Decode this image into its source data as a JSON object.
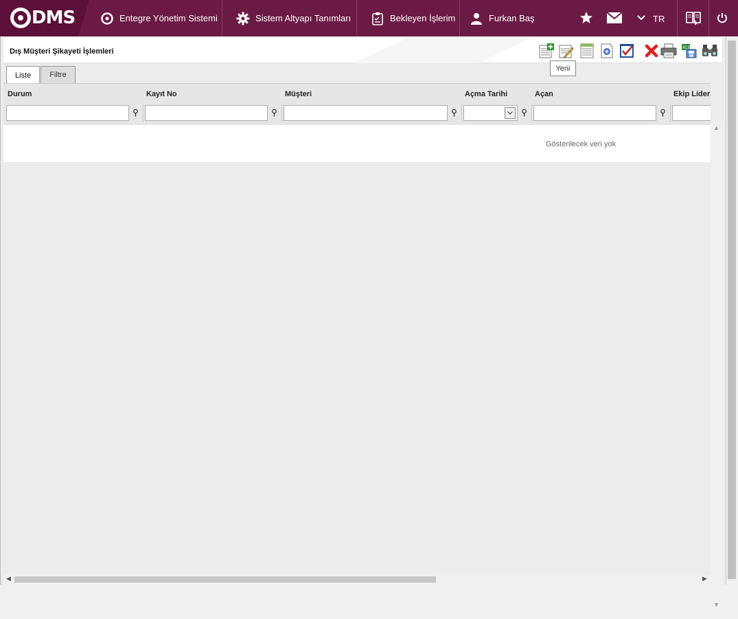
{
  "topbar": {
    "logo_text": "DMS",
    "nav": [
      {
        "label": "Entegre Yönetim Sistemi",
        "icon": "q-circle-icon"
      },
      {
        "label": "Sistem Altyapı Tanımları",
        "icon": "gear-icon"
      },
      {
        "label": "Bekleyen İşlerim",
        "icon": "clipboard-icon"
      },
      {
        "label": "Furkan Baş",
        "icon": "user-icon"
      }
    ],
    "language": "TR"
  },
  "page": {
    "title": "Dış Müşteri Şikayeti İşlemleri",
    "tooltip": "Yeni",
    "tabs": [
      {
        "label": "Liste",
        "active": true
      },
      {
        "label": "Filtre",
        "active": false
      }
    ]
  },
  "grid": {
    "columns": [
      "Durum",
      "Kayıt No",
      "Müşteri",
      "Açma Tarihi",
      "Açan",
      "Ekip Lideri"
    ],
    "empty_message": "Gösterilecek veri yok"
  },
  "colors": {
    "brand": "#6b1a45",
    "brand_dark": "#5c0f38"
  }
}
